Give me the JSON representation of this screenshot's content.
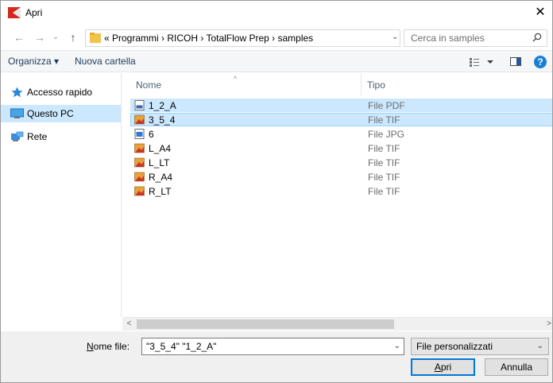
{
  "window": {
    "title": "Apri",
    "close_glyph": "✕"
  },
  "nav": {
    "back_glyph": "←",
    "forward_glyph": "→",
    "recent_glyph": "⌄",
    "up_glyph": "↑",
    "address_path": "« Programmi  ›  RICOH  ›  TotalFlow Prep  ›  samples",
    "address_dropdown_glyph": "⌄",
    "refresh_glyph": "↻",
    "search_placeholder": "Cerca in samples"
  },
  "toolbar": {
    "organize_label": "Organizza ▾",
    "new_folder_label": "Nuova cartella",
    "help_glyph": "?"
  },
  "navpane": {
    "items": [
      {
        "label": "Accesso rapido",
        "icon": "star-icon"
      },
      {
        "label": "Questo PC",
        "icon": "computer-icon",
        "selected": true
      },
      {
        "label": "Rete",
        "icon": "network-icon"
      }
    ]
  },
  "filelist": {
    "columns": {
      "name": "Nome",
      "type": "Tipo"
    },
    "sort_glyph": "^",
    "rows": [
      {
        "name": "1_2_A",
        "type": "File PDF",
        "icon": "pdf-file-icon",
        "selected": true
      },
      {
        "name": "3_5_4",
        "type": "File TIF",
        "icon": "tif-file-icon",
        "selected": true,
        "focused": true
      },
      {
        "name": "6",
        "type": "File JPG",
        "icon": "jpg-file-icon"
      },
      {
        "name": "L_A4",
        "type": "File TIF",
        "icon": "tif-file-icon"
      },
      {
        "name": "L_LT",
        "type": "File TIF",
        "icon": "tif-file-icon"
      },
      {
        "name": "R_A4",
        "type": "File TIF",
        "icon": "tif-file-icon"
      },
      {
        "name": "R_LT",
        "type": "File TIF",
        "icon": "tif-file-icon"
      }
    ]
  },
  "scroll": {
    "left_glyph": "<",
    "right_glyph": ">"
  },
  "bottom": {
    "filename_label_first": "N",
    "filename_label_rest": "ome file:",
    "filename_value": "\"3_5_4\" \"1_2_A\"",
    "filename_drop_glyph": "⌄",
    "filter_value": "File personalizzati",
    "filter_drop_glyph": "⌄",
    "open_label_first": "A",
    "open_label_rest": "pri",
    "cancel_label": "Annulla"
  },
  "colors": {
    "selection": "#cce8ff",
    "selection_border": "#99d1ff",
    "accent": "#0078d7",
    "link_text": "#1e395b"
  }
}
